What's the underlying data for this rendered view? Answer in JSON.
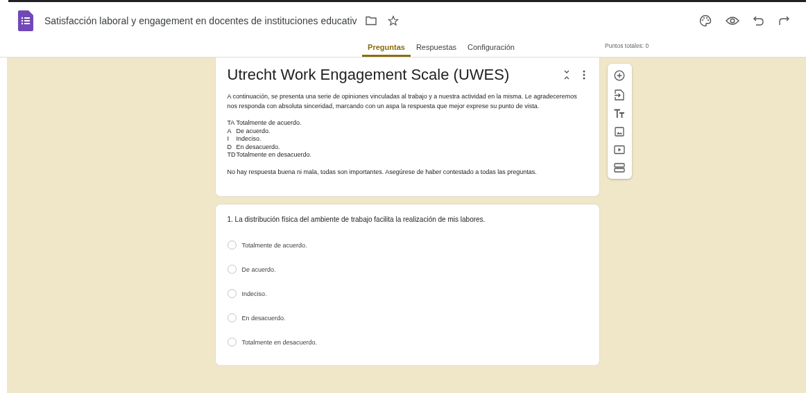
{
  "header": {
    "title": "Satisfacción laboral y engagement en docentes de instituciones educativ",
    "starred": false
  },
  "tabs": [
    {
      "label": "Preguntas",
      "selected": true
    },
    {
      "label": "Respuestas",
      "selected": false
    },
    {
      "label": "Configuración",
      "selected": false
    }
  ],
  "points": "Puntos totales: 0",
  "section": {
    "title": "Utrecht Work Engagement Scale (UWES)",
    "intro": "A continuación, se presenta una serie de opiniones vinculadas al trabajo y a nuestra actividad en la misma. Le agradeceremos nos responda con absoluta sinceridad, marcando con un aspa la respuesta que mejor exprese su punto de vista.",
    "legend": [
      {
        "code": "TA",
        "text": "Totalmente de acuerdo."
      },
      {
        "code": "A",
        "text": "De acuerdo."
      },
      {
        "code": "I",
        "text": "Indeciso."
      },
      {
        "code": "D",
        "text": "En desacuerdo."
      },
      {
        "code": "TD",
        "text": "Totalmente en desacuerdo."
      }
    ],
    "note": "No hay respuesta buena ni mala, todas son importantes. Asegúrese de haber contestado a todas las preguntas."
  },
  "question": {
    "title": "1. La distribución física del ambiente de trabajo facilita la realización de mis labores.",
    "options": [
      {
        "label": "Totalmente de acuerdo.",
        "selected": false
      },
      {
        "label": "De acuerdo.",
        "selected": false
      },
      {
        "label": "Indeciso.",
        "selected": false
      },
      {
        "label": "En desacuerdo.",
        "selected": false
      },
      {
        "label": "Totalmente en desacuerdo.",
        "selected": false
      }
    ]
  }
}
